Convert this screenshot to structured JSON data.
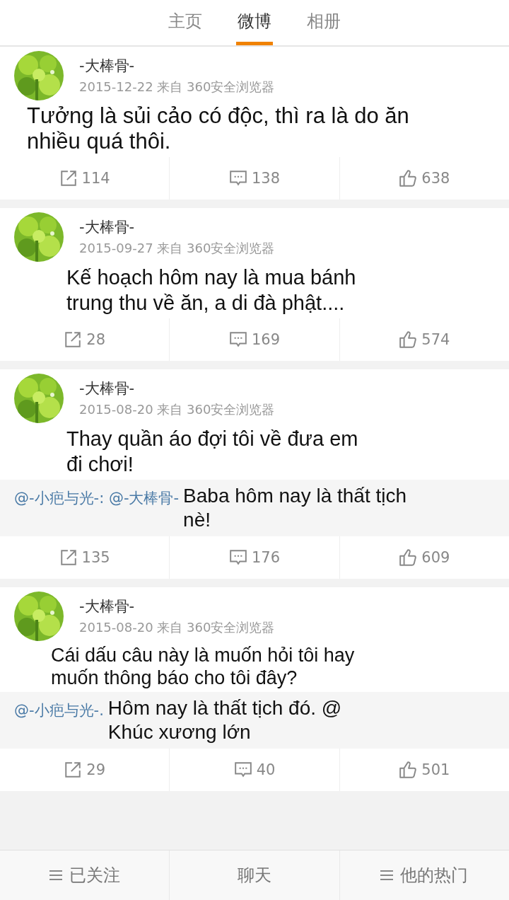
{
  "tabs": [
    {
      "label": "主页",
      "selected": false
    },
    {
      "label": "微博",
      "selected": true
    },
    {
      "label": "相册",
      "selected": false
    }
  ],
  "posts": [
    {
      "author": "-大棒骨-",
      "meta": "2015-12-22 来自 360安全浏览器",
      "text": "Tưởng là sủi cảo có độc, thì ra là do ăn nhiều quá thôi.",
      "reposts": "114",
      "comments": "138",
      "likes": "638"
    },
    {
      "author": "-大棒骨-",
      "meta": "2015-09-27 来自 360安全浏览器",
      "text": "Kế hoạch hôm nay là mua bánh trung thu về ăn, a di đà phật....",
      "reposts": "28",
      "comments": "169",
      "likes": "574"
    },
    {
      "author": "-大棒骨-",
      "meta": "2015-08-20 来自 360安全浏览器",
      "text": "Thay quần áo đợi tôi về đưa em đi chơi!",
      "quote": {
        "mention": "@-小疤与光-: @-大棒骨-",
        "text": "Baba hôm nay là thất tịch nè!"
      },
      "reposts": "135",
      "comments": "176",
      "likes": "609"
    },
    {
      "author": "-大棒骨-",
      "meta": "2015-08-20 来自 360安全浏览器",
      "text": "Cái dấu câu này là muốn hỏi tôi hay muốn thông báo cho tôi đây?",
      "quote": {
        "mention": "@-小疤与光-.",
        "text": "Hôm nay là thất tịch đó. @ Khúc xương lớn"
      },
      "reposts": "29",
      "comments": "40",
      "likes": "501"
    }
  ],
  "bottom_bar": [
    {
      "label": "已关注",
      "kind": "menu"
    },
    {
      "label": "聊天",
      "kind": "plain"
    },
    {
      "label": "他的热门",
      "kind": "menu"
    }
  ]
}
